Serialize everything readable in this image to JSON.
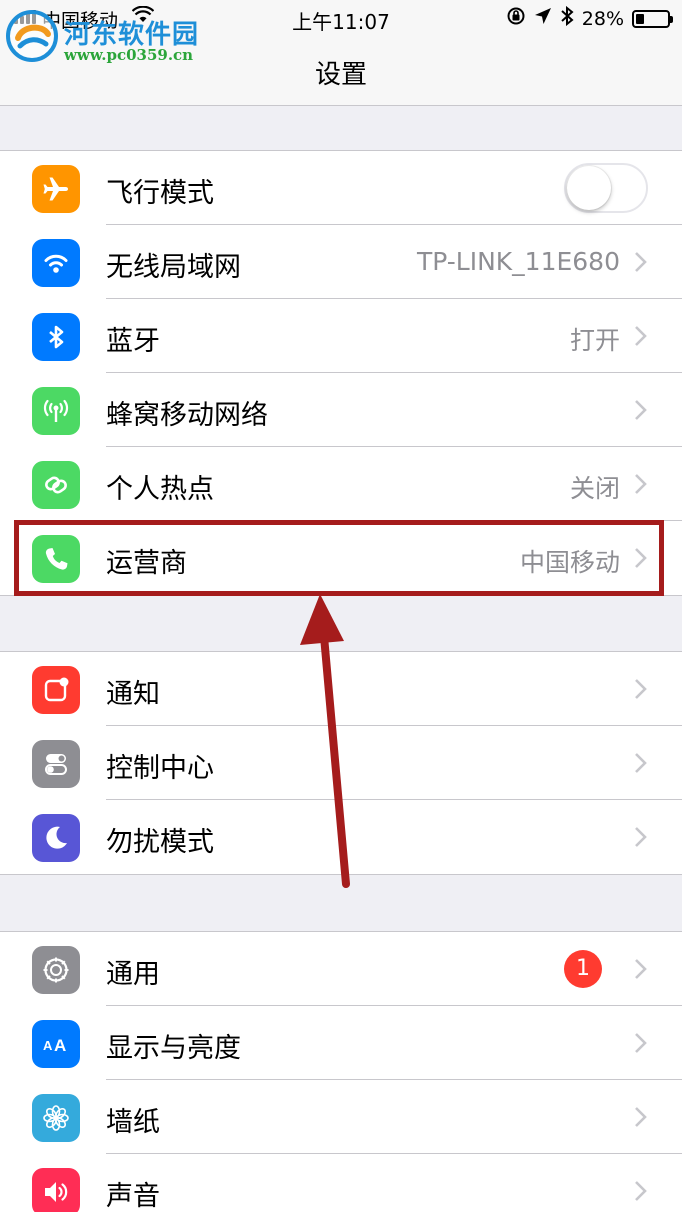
{
  "status_bar": {
    "carrier": "中国移动",
    "time": "上午11:07",
    "battery_percent": "28%",
    "battery_level": 0.28
  },
  "watermark": {
    "title": "河东软件园",
    "url": "www.pc0359.cn"
  },
  "nav": {
    "title": "设置"
  },
  "groups": [
    {
      "rows": [
        {
          "label": "飞行模式",
          "icon": "airplane-icon",
          "icon_color": "#ff9500",
          "control": "toggle",
          "toggle_on": false
        },
        {
          "label": "无线局域网",
          "icon": "wifi-icon",
          "icon_color": "#007aff",
          "value": "TP-LINK_11E680"
        },
        {
          "label": "蓝牙",
          "icon": "bluetooth-icon",
          "icon_color": "#007aff",
          "value": "打开"
        },
        {
          "label": "蜂窝移动网络",
          "icon": "cellular-antenna-icon",
          "icon_color": "#4cd964"
        },
        {
          "label": "个人热点",
          "icon": "hotspot-link-icon",
          "icon_color": "#4cd964",
          "value": "关闭"
        },
        {
          "label": "运营商",
          "icon": "phone-icon",
          "icon_color": "#4cd964",
          "value": "中国移动"
        }
      ]
    },
    {
      "rows": [
        {
          "label": "通知",
          "icon": "notifications-icon",
          "icon_color": "#ff3b30"
        },
        {
          "label": "控制中心",
          "icon": "control-center-icon",
          "icon_color": "#8e8e93"
        },
        {
          "label": "勿扰模式",
          "icon": "moon-icon",
          "icon_color": "#5856d6"
        }
      ]
    },
    {
      "rows": [
        {
          "label": "通用",
          "icon": "gear-icon",
          "icon_color": "#8e8e93",
          "badge": "1"
        },
        {
          "label": "显示与亮度",
          "icon": "text-size-icon",
          "icon_color": "#007aff"
        },
        {
          "label": "墙纸",
          "icon": "flower-icon",
          "icon_color": "#34aadc"
        },
        {
          "label": "声音",
          "icon": "speaker-icon",
          "icon_color": "#ff2d55"
        }
      ]
    }
  ],
  "annotation": {
    "highlight_color": "#a51c1c"
  }
}
